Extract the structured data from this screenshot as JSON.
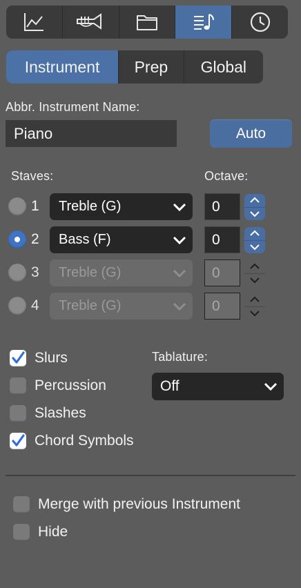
{
  "toolbar": {
    "items": [
      {
        "icon": "graph-icon",
        "active": false
      },
      {
        "icon": "trumpet-icon",
        "active": false
      },
      {
        "icon": "folder-icon",
        "active": false
      },
      {
        "icon": "score-settings-icon",
        "active": true
      },
      {
        "icon": "clock-icon",
        "active": false
      }
    ]
  },
  "tabs": {
    "items": [
      {
        "label": "Instrument",
        "active": true
      },
      {
        "label": "Prep",
        "active": false
      },
      {
        "label": "Global",
        "active": false
      }
    ]
  },
  "instrument_name": {
    "label": "Abbr. Instrument Name:",
    "value": "Piano",
    "auto_label": "Auto"
  },
  "staves": {
    "label": "Staves:",
    "octave_label": "Octave:",
    "rows": [
      {
        "number": "1",
        "clef": "Treble (G)",
        "octave": "0",
        "selected": false,
        "enabled": true
      },
      {
        "number": "2",
        "clef": "Bass (F)",
        "octave": "0",
        "selected": true,
        "enabled": true
      },
      {
        "number": "3",
        "clef": "Treble (G)",
        "octave": "0",
        "selected": false,
        "enabled": false
      },
      {
        "number": "4",
        "clef": "Treble (G)",
        "octave": "0",
        "selected": false,
        "enabled": false
      }
    ]
  },
  "options": {
    "slurs": {
      "label": "Slurs",
      "checked": true
    },
    "percussion": {
      "label": "Percussion",
      "checked": false
    },
    "slashes": {
      "label": "Slashes",
      "checked": false
    },
    "chord_symbols": {
      "label": "Chord Symbols",
      "checked": true
    }
  },
  "tablature": {
    "label": "Tablature:",
    "value": "Off"
  },
  "bottom": {
    "merge": {
      "label": "Merge with previous Instrument",
      "checked": false
    },
    "hide": {
      "label": "Hide",
      "checked": false
    }
  },
  "colors": {
    "background": "#5c5c5c",
    "accent": "#4b71a6",
    "dark_control": "#262626"
  }
}
